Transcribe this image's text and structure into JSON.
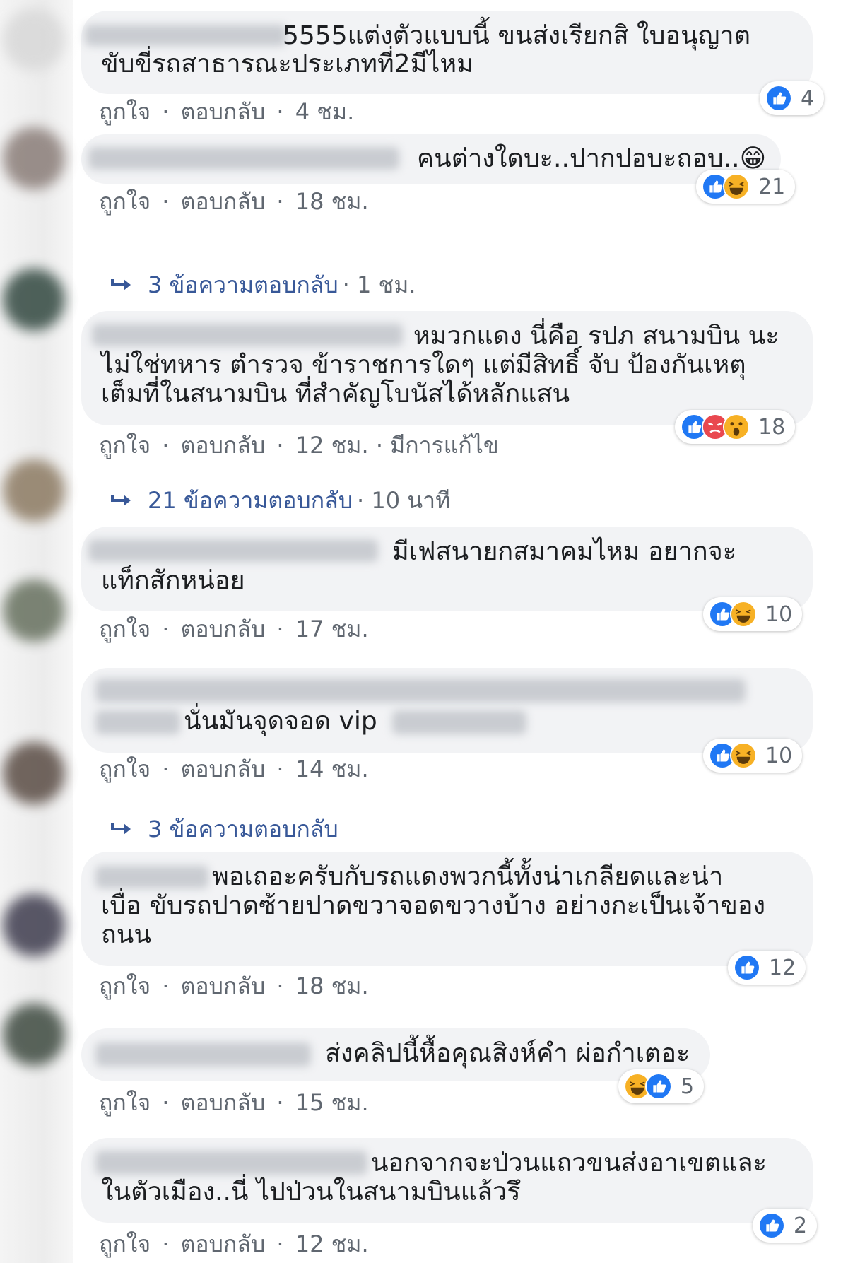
{
  "colors": {
    "link": "#385898",
    "meta": "#606770",
    "bubble": "#f2f3f5",
    "like": "#2078f4",
    "haha": "#f7b125",
    "angry": "#e9484f"
  },
  "comments": [
    {
      "text_lines": [
        "5555แต่งตัวแบบนี้ ขนส่งเรียกสิ ใบอนุญาต",
        "ขับขี่รถสาธารณะประเภทที่2มีไหม"
      ],
      "actions": {
        "like": "ถูกใจ",
        "sep1": "·",
        "reply": "ตอบกลับ",
        "sep2": "·",
        "time": "4 ชม.",
        "edited": ""
      },
      "reactions": {
        "icons": [
          "like-icon"
        ],
        "count": "4"
      },
      "replies": null
    },
    {
      "text_lines": [
        "คนต่างใดบะ..ปากปอบะถอบ..😁"
      ],
      "actions": {
        "like": "ถูกใจ",
        "sep1": "·",
        "reply": "ตอบกลับ",
        "sep2": "·",
        "time": "18 ชม.",
        "edited": ""
      },
      "reactions": {
        "icons": [
          "like-icon",
          "haha-icon"
        ],
        "count": "21"
      },
      "replies": {
        "label": "3 ข้อความตอบกลับ",
        "time": "· 1 ชม."
      }
    },
    {
      "text_lines": [
        "หมวกแดง นี่คือ รปภ สนามบิน นะ",
        "ไม่ใช่ทหาร ตำรวจ ข้าราชการใดๆ แต่มีสิทธิ์ จับ ป้องกันเหตุ",
        "เต็มที่ในสนามบิน ที่สำคัญโบนัสได้หลักแสน"
      ],
      "actions": {
        "like": "ถูกใจ",
        "sep1": "·",
        "reply": "ตอบกลับ",
        "sep2": "·",
        "time": "12 ชม.",
        "edited": "· มีการแก้ไข"
      },
      "reactions": {
        "icons": [
          "like-icon",
          "angry-icon",
          "wow-icon"
        ],
        "count": "18"
      },
      "replies": {
        "label": "21 ข้อความตอบกลับ",
        "time": "· 10 นาที"
      }
    },
    {
      "text_lines": [
        "มีเฟสนายกสมาคมไหม อยากจะ",
        "แท็กสักหน่อย"
      ],
      "actions": {
        "like": "ถูกใจ",
        "sep1": "·",
        "reply": "ตอบกลับ",
        "sep2": "·",
        "time": "17 ชม.",
        "edited": ""
      },
      "reactions": {
        "icons": [
          "like-icon",
          "haha-icon"
        ],
        "count": "10"
      },
      "replies": null
    },
    {
      "text_lines": [
        "นั่นมันจุดจอด vip"
      ],
      "actions": {
        "like": "ถูกใจ",
        "sep1": "·",
        "reply": "ตอบกลับ",
        "sep2": "·",
        "time": "14 ชม.",
        "edited": ""
      },
      "reactions": {
        "icons": [
          "like-icon",
          "haha-icon"
        ],
        "count": "10"
      },
      "replies": {
        "label": "3 ข้อความตอบกลับ",
        "time": ""
      }
    },
    {
      "text_lines": [
        "พอเถอะครับกับรถแดงพวกนี้ทั้งน่าเกลียดและน่า",
        "เบื่อ ขับรถปาดซ้ายปาดขวาจอดขวางบ้าง อย่างกะเป็นเจ้าของ",
        "ถนน"
      ],
      "actions": {
        "like": "ถูกใจ",
        "sep1": "·",
        "reply": "ตอบกลับ",
        "sep2": "·",
        "time": "18 ชม.",
        "edited": ""
      },
      "reactions": {
        "icons": [
          "like-icon"
        ],
        "count": "12"
      },
      "replies": null
    },
    {
      "text_lines": [
        "ส่งคลิปนี้หื้อคุณสิงห์คำ ผ่อกำเตอะ"
      ],
      "actions": {
        "like": "ถูกใจ",
        "sep1": "·",
        "reply": "ตอบกลับ",
        "sep2": "·",
        "time": "15 ชม.",
        "edited": ""
      },
      "reactions": {
        "icons": [
          "haha-icon",
          "like-icon"
        ],
        "count": "5"
      },
      "replies": null
    },
    {
      "text_lines": [
        "นอกจากจะป่วนแถวขนส่งอาเขตและ",
        "ในตัวเมือง..นี่ ไปป่วนในสนามบินแล้วรึ"
      ],
      "actions": {
        "like": "ถูกใจ",
        "sep1": "·",
        "reply": "ตอบกลับ",
        "sep2": "·",
        "time": "12 ชม.",
        "edited": ""
      },
      "reactions": {
        "icons": [
          "like-icon"
        ],
        "count": "2"
      },
      "replies": null
    }
  ]
}
